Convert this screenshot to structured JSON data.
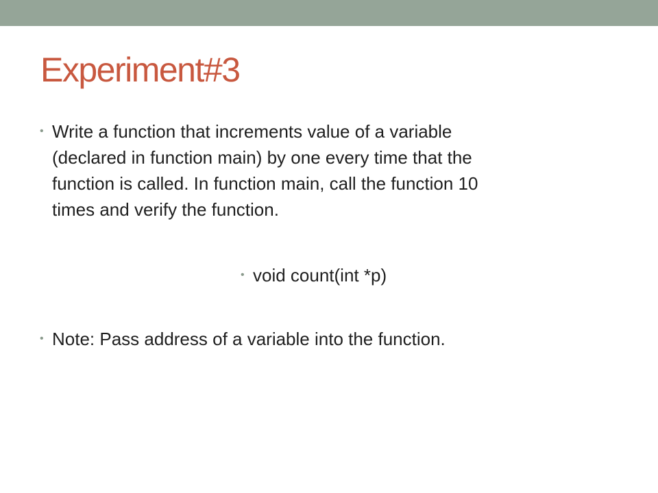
{
  "slide": {
    "title": "Experiment#3",
    "colors": {
      "top_bar": "#95a598",
      "title": "#c8583f",
      "body_text": "#1e1e1e",
      "bullet": "#8a9a8c"
    },
    "bullets": [
      {
        "lines": [
          "Write a function that increments value of a variable",
          "(declared in function main) by one every time that the",
          "function is called. In function main, call the function 10",
          "times and verify the function."
        ]
      },
      {
        "text": "void count(int *p)"
      },
      {
        "text": "Note: Pass address of a variable into the function."
      }
    ]
  }
}
